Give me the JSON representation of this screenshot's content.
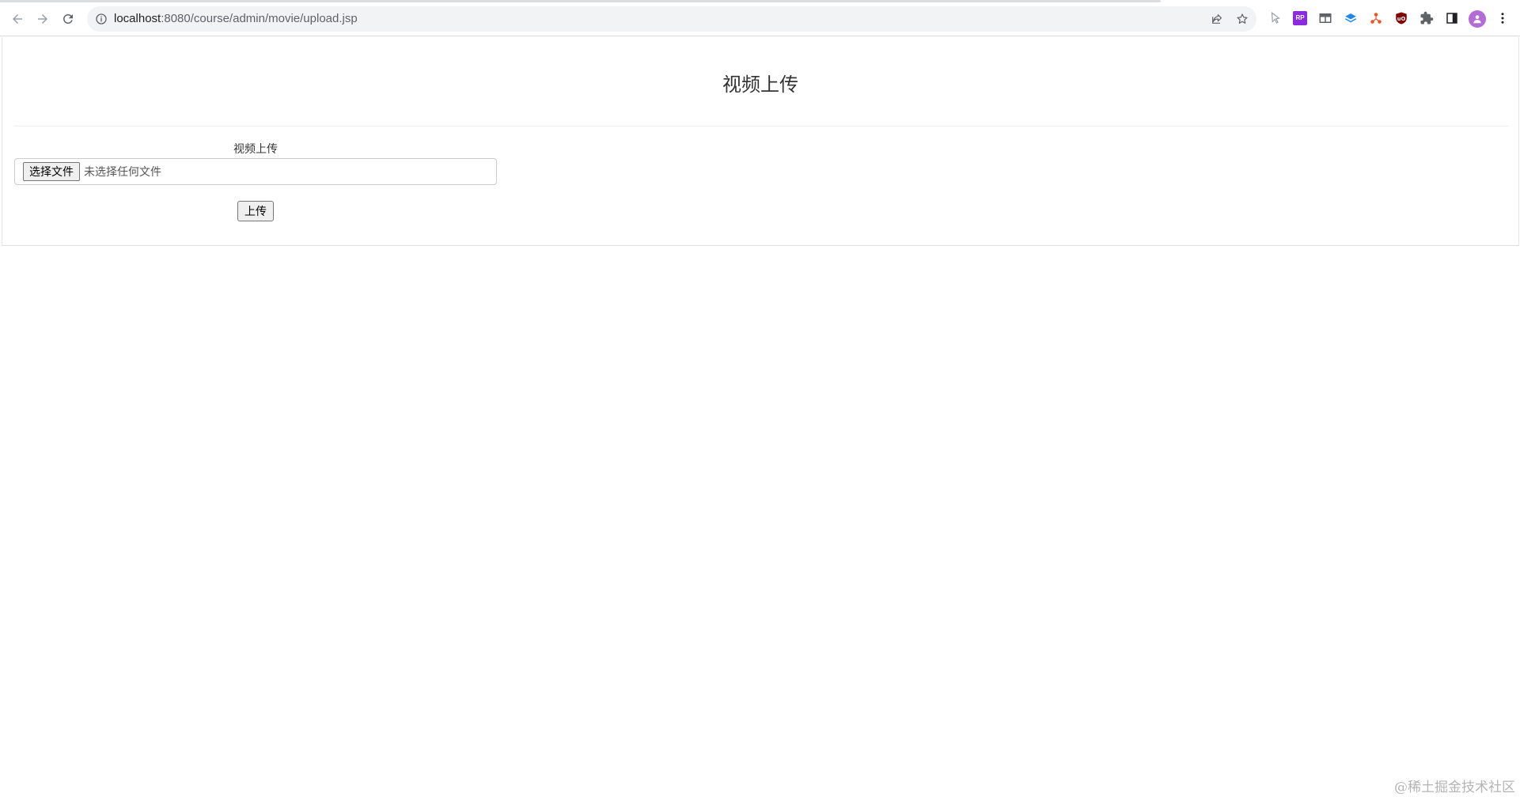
{
  "browser": {
    "url_host": "localhost",
    "url_path": ":8080/course/admin/movie/upload.jsp"
  },
  "page": {
    "title": "视频上传",
    "field_label": "视频上传",
    "file_button_label": "选择文件",
    "file_status": "未选择任何文件",
    "submit_label": "上传"
  },
  "watermark": "@稀土掘金技术社区",
  "colors": {
    "chrome_bg": "#ffffff",
    "omnibox_bg": "#f1f3f4",
    "avatar": "#b36bd6"
  }
}
